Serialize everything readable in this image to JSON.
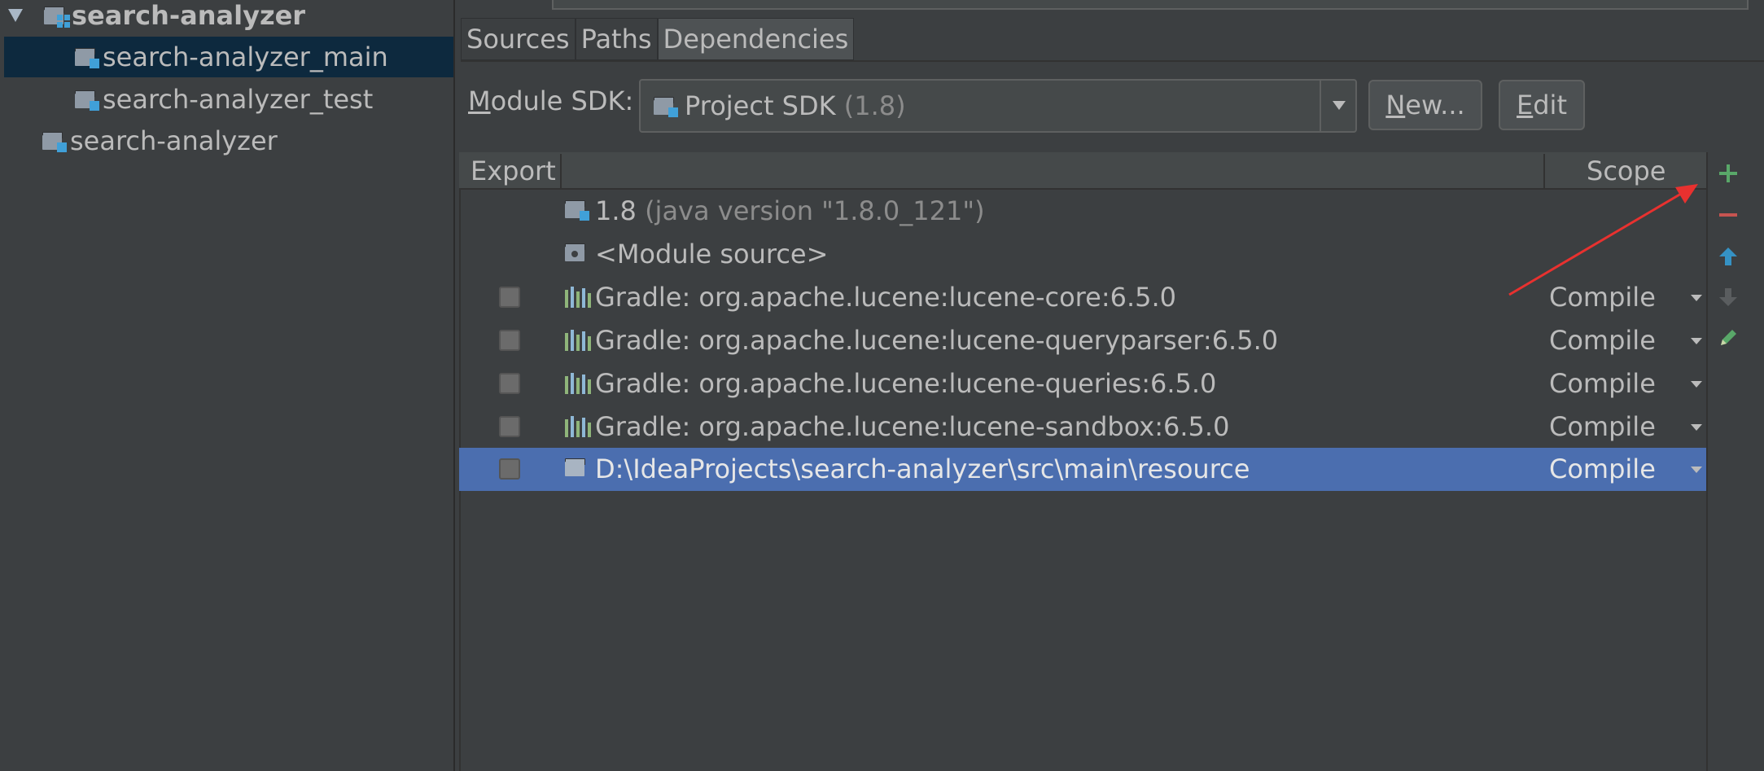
{
  "tree": {
    "items": [
      {
        "label": "search-analyzer",
        "bold": true
      },
      {
        "label": "search-analyzer_main"
      },
      {
        "label": "search-analyzer_test"
      },
      {
        "label": "search-analyzer"
      }
    ]
  },
  "tabs": [
    {
      "label": "Sources"
    },
    {
      "label": "Paths"
    },
    {
      "label": "Dependencies",
      "active": true
    }
  ],
  "sdk": {
    "label_prefix": "M",
    "label_rest": "odule SDK:",
    "value": "Project SDK",
    "value_dim": "(1.8)",
    "new_prefix": "N",
    "new_rest": "ew...",
    "edit_prefix": "E",
    "edit_rest": "dit"
  },
  "table": {
    "headers": {
      "export": "Export",
      "scope": "Scope"
    },
    "rows": [
      {
        "name": "1.8",
        "detail": "(java version \"1.8.0_121\")",
        "icon": "jdk-folder-icon",
        "scope": "",
        "checkbox": false
      },
      {
        "name": "<Module source>",
        "icon": "module-source-icon",
        "scope": "",
        "checkbox": false
      },
      {
        "name": "Gradle: org.apache.lucene:lucene-core:6.5.0",
        "icon": "library-icon",
        "scope": "Compile",
        "checkbox": true
      },
      {
        "name": "Gradle: org.apache.lucene:lucene-queryparser:6.5.0",
        "icon": "library-icon",
        "scope": "Compile",
        "checkbox": true
      },
      {
        "name": "Gradle: org.apache.lucene:lucene-queries:6.5.0",
        "icon": "library-icon",
        "scope": "Compile",
        "checkbox": true
      },
      {
        "name": "Gradle: org.apache.lucene:lucene-sandbox:6.5.0",
        "icon": "library-icon",
        "scope": "Compile",
        "checkbox": true
      },
      {
        "name": "D:\\IdeaProjects\\search-analyzer\\src\\main\\resource",
        "icon": "folder-icon",
        "scope": "Compile",
        "checkbox": true,
        "selected": true
      }
    ]
  },
  "toolbar": {
    "icons": [
      "add-icon",
      "remove-icon",
      "move-up-icon",
      "move-down-icon",
      "edit-pencil-icon"
    ]
  },
  "colors": {
    "background": "#3c3f41",
    "selection": "#4b6eaf",
    "tree_selection": "#0d293e",
    "link": "#589df6",
    "add": "#59a869",
    "remove": "#c75450",
    "annotation_arrow": "#e8312f"
  }
}
